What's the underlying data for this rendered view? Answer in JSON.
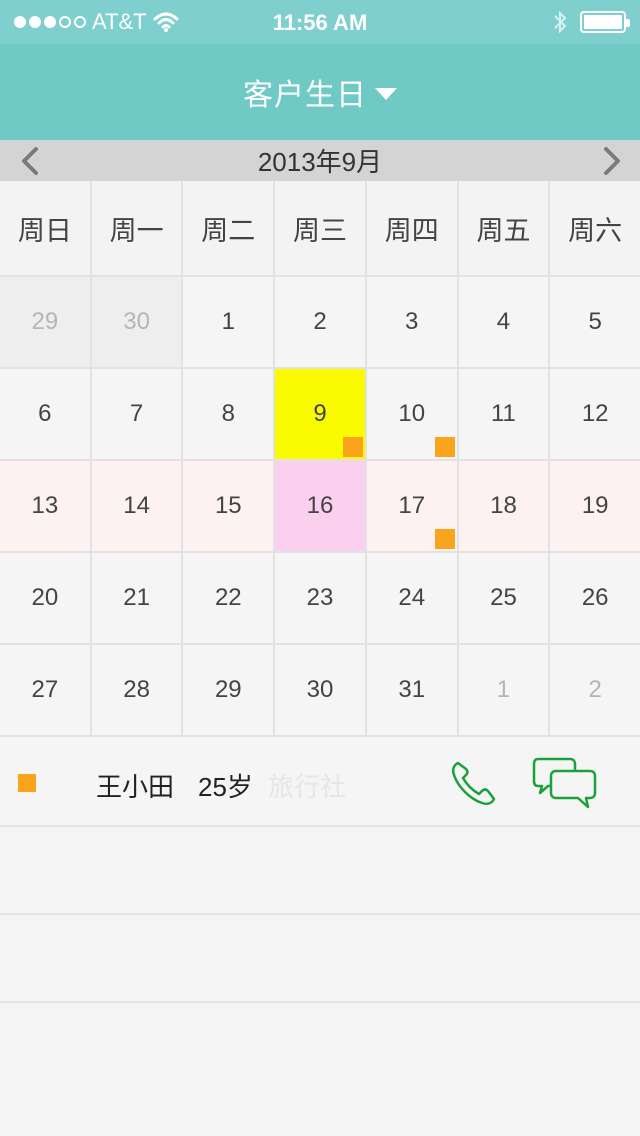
{
  "status_bar": {
    "carrier": "AT&T",
    "time": "11:56 AM",
    "signal_bars_filled": 3,
    "signal_bars_total": 5
  },
  "nav": {
    "title": "客户生日",
    "dropdown_icon": "caret-down-icon"
  },
  "calendar": {
    "month_label": "2013年9月",
    "prev_icon": "chevron-left-icon",
    "next_icon": "chevron-right-icon",
    "weekdays": [
      "周日",
      "周一",
      "周二",
      "周三",
      "周四",
      "周五",
      "周六"
    ],
    "weeks": [
      [
        "29",
        "30",
        "1",
        "2",
        "3",
        "4",
        "5"
      ],
      [
        "6",
        "7",
        "8",
        "9",
        "10",
        "11",
        "12"
      ],
      [
        "13",
        "14",
        "15",
        "16",
        "17",
        "18",
        "19"
      ],
      [
        "20",
        "21",
        "22",
        "23",
        "24",
        "25",
        "26"
      ],
      [
        "27",
        "28",
        "29",
        "30",
        "31",
        "1",
        "2"
      ]
    ],
    "today": "9",
    "selected": "16",
    "birthday_marked_days": [
      "9",
      "10",
      "17"
    ],
    "colors": {
      "marker": "#f9a41c",
      "today": "#fbfb00",
      "selected": "#fbd0ee",
      "header": "#6fcac6"
    }
  },
  "birthday_list": [
    {
      "name": "王小田",
      "age": "25岁",
      "note": "旅行社",
      "call_icon": "phone-icon",
      "message_icon": "chat-bubbles-icon"
    }
  ]
}
